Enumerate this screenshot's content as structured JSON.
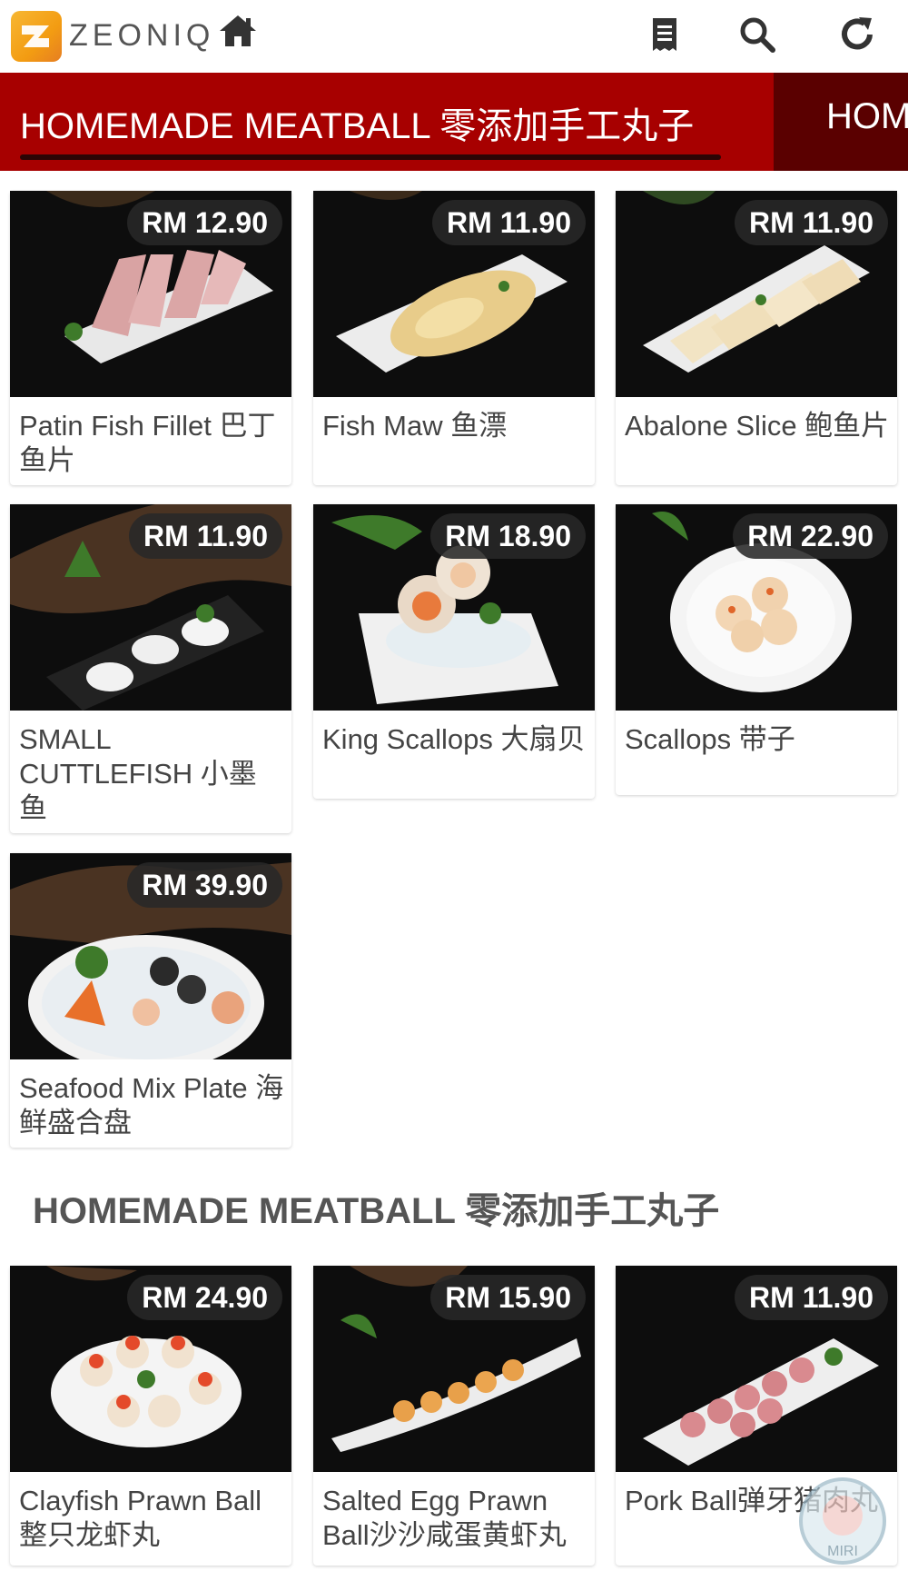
{
  "header": {
    "brand": "ZEONIQ",
    "icons": [
      "home-icon",
      "menu-list-icon",
      "search-icon",
      "refresh-icon"
    ]
  },
  "category_bar": {
    "active": "HOMEMADE MEATBALL 零添加手工丸子",
    "next": "HOM"
  },
  "seafood_items": [
    {
      "price": "RM 12.90",
      "name": "Patin Fish Fillet 巴丁鱼片"
    },
    {
      "price": "RM 11.90",
      "name": "Fish Maw 鱼漂"
    },
    {
      "price": "RM 11.90",
      "name": "Abalone Slice 鲍鱼片"
    },
    {
      "price": "RM 11.90",
      "name": "SMALL CUTTLEFISH 小墨鱼"
    },
    {
      "price": "RM 18.90",
      "name": "King Scallops 大扇贝"
    },
    {
      "price": "RM 22.90",
      "name": "Scallops 带子"
    },
    {
      "price": "RM 39.90",
      "name": "Seafood Mix Plate 海鲜盛合盘"
    }
  ],
  "meatball_section": {
    "title": "HOMEMADE MEATBALL 零添加手工丸子",
    "items": [
      {
        "price": "RM 24.90",
        "name": "Clayfish Prawn Ball 整只龙虾丸"
      },
      {
        "price": "RM 15.90",
        "name": "Salted Egg Prawn Ball沙沙咸蛋黄虾丸"
      },
      {
        "price": "RM 11.90",
        "name": "Pork Ball弹牙猪肉丸"
      }
    ]
  },
  "watermark": {
    "text": "MIRI"
  },
  "colors": {
    "accent_red": "#b30000",
    "price_badge": "#282828",
    "logo_orange": "#f39c12"
  }
}
